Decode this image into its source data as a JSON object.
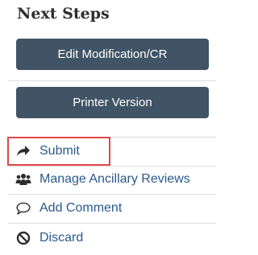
{
  "panel": {
    "heading": "Next Steps",
    "buttons": [
      {
        "label": "Edit Modification/CR"
      },
      {
        "label": "Printer Version"
      }
    ],
    "actions": [
      {
        "label": "Submit",
        "icon": "share-arrow-icon",
        "highlighted": true
      },
      {
        "label": "Manage Ancillary Reviews",
        "icon": "users-icon"
      },
      {
        "label": "Add Comment",
        "icon": "comment-icon"
      },
      {
        "label": "Discard",
        "icon": "ban-icon"
      }
    ]
  },
  "colors": {
    "button_bg": "#405465",
    "link_text": "#2a5a8c",
    "highlight_border": "#e04848"
  }
}
